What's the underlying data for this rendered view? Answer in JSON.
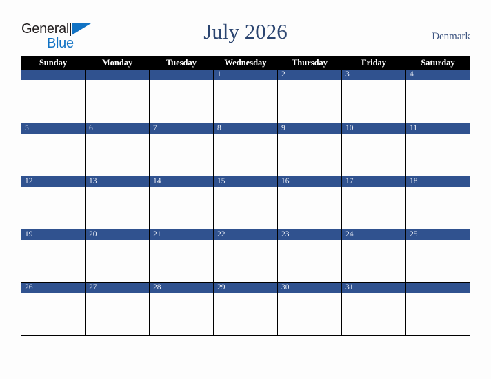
{
  "brand": {
    "word_general": "General",
    "word_blue": "Blue",
    "triangle_color": "#1273c4",
    "text_color": "#231f20"
  },
  "header": {
    "title": "July 2026",
    "country": "Denmark",
    "title_color": "#2b4570",
    "country_color": "#3d5480"
  },
  "calendar": {
    "month": "July",
    "year": "2026",
    "header_bg": "#000000",
    "header_text_color": "#ffffff",
    "daybar_bg": "#30528f",
    "daybar_text_color": "#e8ecf4",
    "cell_bg": "#fdfdfd",
    "weekdays": [
      "Sunday",
      "Monday",
      "Tuesday",
      "Wednesday",
      "Thursday",
      "Friday",
      "Saturday"
    ],
    "weeks": [
      [
        "",
        "",
        "",
        "1",
        "2",
        "3",
        "4"
      ],
      [
        "5",
        "6",
        "7",
        "8",
        "9",
        "10",
        "11"
      ],
      [
        "12",
        "13",
        "14",
        "15",
        "16",
        "17",
        "18"
      ],
      [
        "19",
        "20",
        "21",
        "22",
        "23",
        "24",
        "25"
      ],
      [
        "26",
        "27",
        "28",
        "29",
        "30",
        "31",
        ""
      ]
    ]
  }
}
